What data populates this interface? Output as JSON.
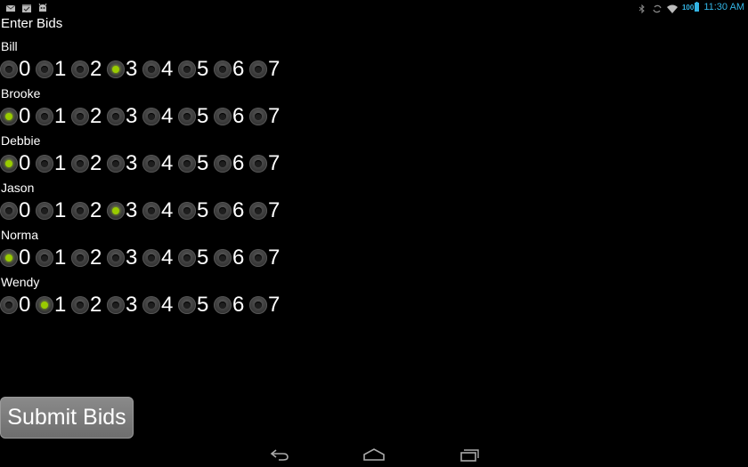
{
  "status_bar": {
    "notification_icons": [
      "mail-icon",
      "calendar-icon",
      "android-debug-icon"
    ],
    "system_icons": [
      "bluetooth-icon",
      "rotate-icon",
      "wifi-icon",
      "battery-icon"
    ],
    "battery_level": "100",
    "time": "11:30 AM",
    "accent_color": "#33b5e5"
  },
  "title": "Enter Bids",
  "bid_options": [
    "0",
    "1",
    "2",
    "3",
    "4",
    "5",
    "6",
    "7"
  ],
  "players": [
    {
      "name": "Bill",
      "selected": "3"
    },
    {
      "name": "Brooke",
      "selected": "0"
    },
    {
      "name": "Debbie",
      "selected": "0"
    },
    {
      "name": "Jason",
      "selected": "3"
    },
    {
      "name": "Norma",
      "selected": "0"
    },
    {
      "name": "Wendy",
      "selected": "1"
    }
  ],
  "radio_checked_color": "#99cc00",
  "submit_label": "Submit Bids",
  "nav_bar": {
    "icons": [
      "back-icon",
      "home-icon",
      "recent-apps-icon"
    ]
  }
}
